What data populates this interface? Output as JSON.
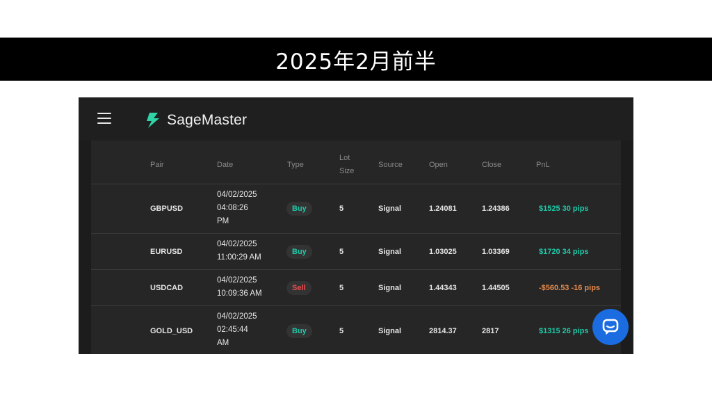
{
  "slide": {
    "title": "2025年2月前半"
  },
  "app": {
    "brand": "SageMaster",
    "brand_color": "#2fd3a6"
  },
  "table": {
    "headers": {
      "pair": "Pair",
      "date": "Date",
      "type": "Type",
      "lot_line1": "Lot",
      "lot_line2": "Size",
      "source": "Source",
      "open": "Open",
      "close": "Close",
      "pnl": "PnL"
    },
    "rows": [
      {
        "pair": "GBPUSD",
        "date1": "04/02/2025",
        "date2": "04:08:26",
        "date3": "PM",
        "type": "Buy",
        "lot": "5",
        "source": "Signal",
        "open": "1.24081",
        "close": "1.24386",
        "pnl": "$1525 30 pips"
      },
      {
        "pair": "EURUSD",
        "date1": "04/02/2025",
        "date2": "11:00:29 AM",
        "date3": "",
        "type": "Buy",
        "lot": "5",
        "source": "Signal",
        "open": "1.03025",
        "close": "1.03369",
        "pnl": "$1720 34 pips"
      },
      {
        "pair": "USDCAD",
        "date1": "04/02/2025",
        "date2": "10:09:36 AM",
        "date3": "",
        "type": "Sell",
        "lot": "5",
        "source": "Signal",
        "open": "1.44343",
        "close": "1.44505",
        "pnl": "-$560.53 -16 pips"
      },
      {
        "pair": "GOLD_USD",
        "date1": "04/02/2025",
        "date2": "02:45:44",
        "date3": "AM",
        "type": "Buy",
        "lot": "5",
        "source": "Signal",
        "open": "2814.37",
        "close": "2817",
        "pnl": "$1315 26 pips"
      }
    ]
  },
  "colors": {
    "buy": "#1ec9a9",
    "sell": "#ea4d4d",
    "loss": "#e88a4a",
    "chat": "#1b6ce0"
  },
  "icons": {
    "menu": "hamburger-icon",
    "chat": "chat-bubble-icon",
    "logo": "bolt-logo-icon"
  }
}
